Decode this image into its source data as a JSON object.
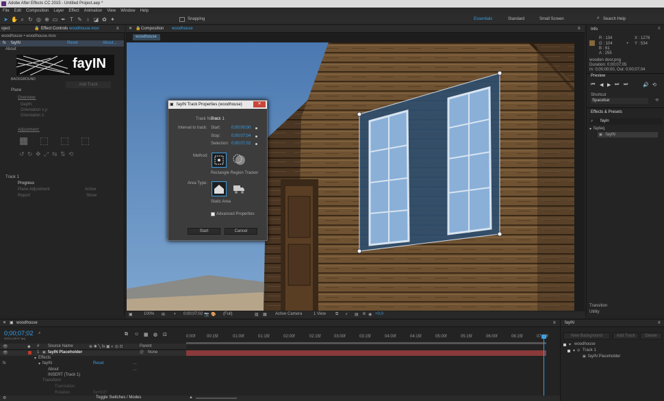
{
  "window": {
    "title": "Adobe After Effects CC 2015 - Untitled Project.aep *"
  },
  "menu": [
    "File",
    "Edit",
    "Composition",
    "Layer",
    "Effect",
    "Animation",
    "View",
    "Window",
    "Help"
  ],
  "toolbar": {
    "snapping": "Snapping",
    "workspaces": [
      "Essentials",
      "Standard",
      "Small Screen"
    ],
    "search_placeholder": "Search Help"
  },
  "effect_controls": {
    "tab_project": "oject",
    "tab_title": "Effect Controls",
    "tab_file": "woodhouse.mov",
    "breadcrumb": "woodhouse • woodhouse.mov",
    "effect_name": "fayIN",
    "reset": "Reset",
    "about": "About...",
    "about_section": "About",
    "logo_text": "fayIN",
    "background": "BACKGROUND",
    "add_track": "Add Track",
    "plane": "Plane",
    "overview": "Overview:",
    "depth": "Depth:",
    "orientation_x": "Orientation x,y:",
    "orientation_z": "Orientation z:",
    "adjustment": "Adjustment:",
    "track": "Track 1",
    "progress": "Progress",
    "plane_adjustment": "Plane Adjustment",
    "active": "Active",
    "report": "Report",
    "show": "Show"
  },
  "composition": {
    "tab_label": "Composition",
    "comp_name": "woodhouse",
    "sub_tab": "woodhouse",
    "zoom": "100%",
    "timecode": "0;00;07;02",
    "resolution": "(Full)",
    "camera": "Active Camera",
    "view": "1 View",
    "exposure": "+0,0"
  },
  "dialog": {
    "title": "fayIN Track Properties (woodhouse)",
    "close": "✕",
    "track_name_label": "Track Name:",
    "track_name": "Track 1",
    "interval_label": "Interval to track:",
    "start_label": "Start:",
    "start_value": "0;00;00;00",
    "stop_label": "Stop:",
    "stop_value": "0;00;07;04",
    "selection_label": "Selection:",
    "selection_value": "0;00;07;02",
    "method_label": "Method:",
    "method_value": "Rectangle Region Tracker",
    "area_label": "Area Type:",
    "area_value": "Static Area",
    "advanced": "Advanced Properties",
    "start_btn": "Start",
    "cancel_btn": "Cancel"
  },
  "info": {
    "title": "Info",
    "r": "R : 134",
    "g": "G : 104",
    "b": "B : 61",
    "a": "A : 255",
    "x": "X : 1278",
    "y": "Y : 534",
    "file": "wooden door.png",
    "duration": "Duration: 0;00;07;05",
    "in_out": "In: 0;00;00;00, Out: 0;00;07;04",
    "swatch": "#86683d"
  },
  "preview": {
    "title": "Preview",
    "shortcut_label": "Shortcut",
    "shortcut_value": "Spacebar"
  },
  "effects_presets": {
    "title": "Effects & Presets",
    "search": "fayin",
    "category": "fayteq",
    "item": "fayIN",
    "transition": "Transition",
    "utility": "Utility"
  },
  "timeline": {
    "tab": "woodhouse",
    "timecode": "0;00;07;02",
    "fps": "00212 (29.97 fps)",
    "col_source": "Source Name",
    "col_parent": "Parent",
    "layer_num": "1",
    "layer_name": "fayIN Placeholder",
    "parent_value": "None",
    "effects": "Effects",
    "effect": "fayIN",
    "reset": "Reset",
    "about": "About",
    "insert": "INSERT (Track 1)",
    "transform": "Transform",
    "translation": "Translation",
    "rotation": "Rotation",
    "rotation_value": "0x+0,0°",
    "toggle": "Toggle Switches / Modes",
    "ruler": [
      "0:00f",
      "00:15f",
      "01:00f",
      "01:15f",
      "02:00f",
      "02:15f",
      "03:00f",
      "03:15f",
      "04:00f",
      "04:15f",
      "05:00f",
      "05:15f",
      "06:00f",
      "06:15f",
      "07:00f"
    ]
  },
  "fayin_panel": {
    "tab": "fayIN",
    "new_background": "New Background",
    "add_track": "Add Track",
    "delete": "Delete",
    "root": "woodhouse",
    "track": "Track 1",
    "placeholder": "fayIN Placeholder"
  }
}
